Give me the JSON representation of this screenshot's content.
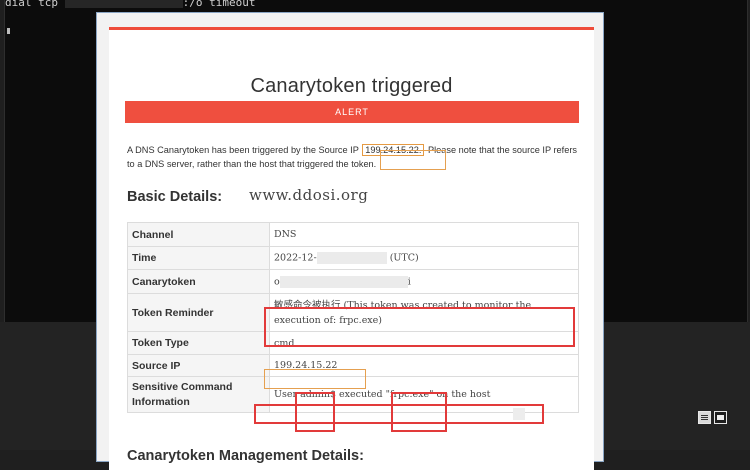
{
  "terminal": {
    "line_prefix": "dial tcp",
    "line_suffix": ":/o timeout"
  },
  "popup": {
    "title": "Canarytoken triggered",
    "alert_label": "ALERT",
    "intro_before": "A DNS Canarytoken has been triggered by the Source IP ",
    "intro_ip": "199.24.15.22.",
    "intro_after": " Please note that the source IP refers to a DNS server, rather than the host that triggered the token.",
    "basic_details_heading": "Basic Details:",
    "watermark": "www.ddosi.org",
    "details": {
      "channel_label": "Channel",
      "channel_value": "DNS",
      "time_label": "Time",
      "time_value": "2022-12-",
      "time_suffix": "(UTC)",
      "canarytoken_label": "Canarytoken",
      "canarytoken_prefix": "o",
      "canarytoken_suffix": "i",
      "token_reminder_label": "Token Reminder",
      "token_reminder_value": "敏感命令被执行 (This token was created to monitor the execution of: frpc.exe)",
      "token_type_label": "Token Type",
      "token_type_value": "cmd",
      "source_ip_label": "Source IP",
      "source_ip_value": "199.24.15.22",
      "sensitive_label": "Sensitive Command Information",
      "sensitive_value": "User admin$ executed \"frpc.exe\" on the host"
    },
    "management_heading": "Canarytoken Management Details:"
  },
  "icons": {
    "status_icon_1": "list-view-icon",
    "status_icon_2": "window-icon"
  },
  "colors": {
    "alert_red": "#ef4f3f",
    "highlight_red": "#e23a3a",
    "highlight_orange": "#e5a050"
  }
}
